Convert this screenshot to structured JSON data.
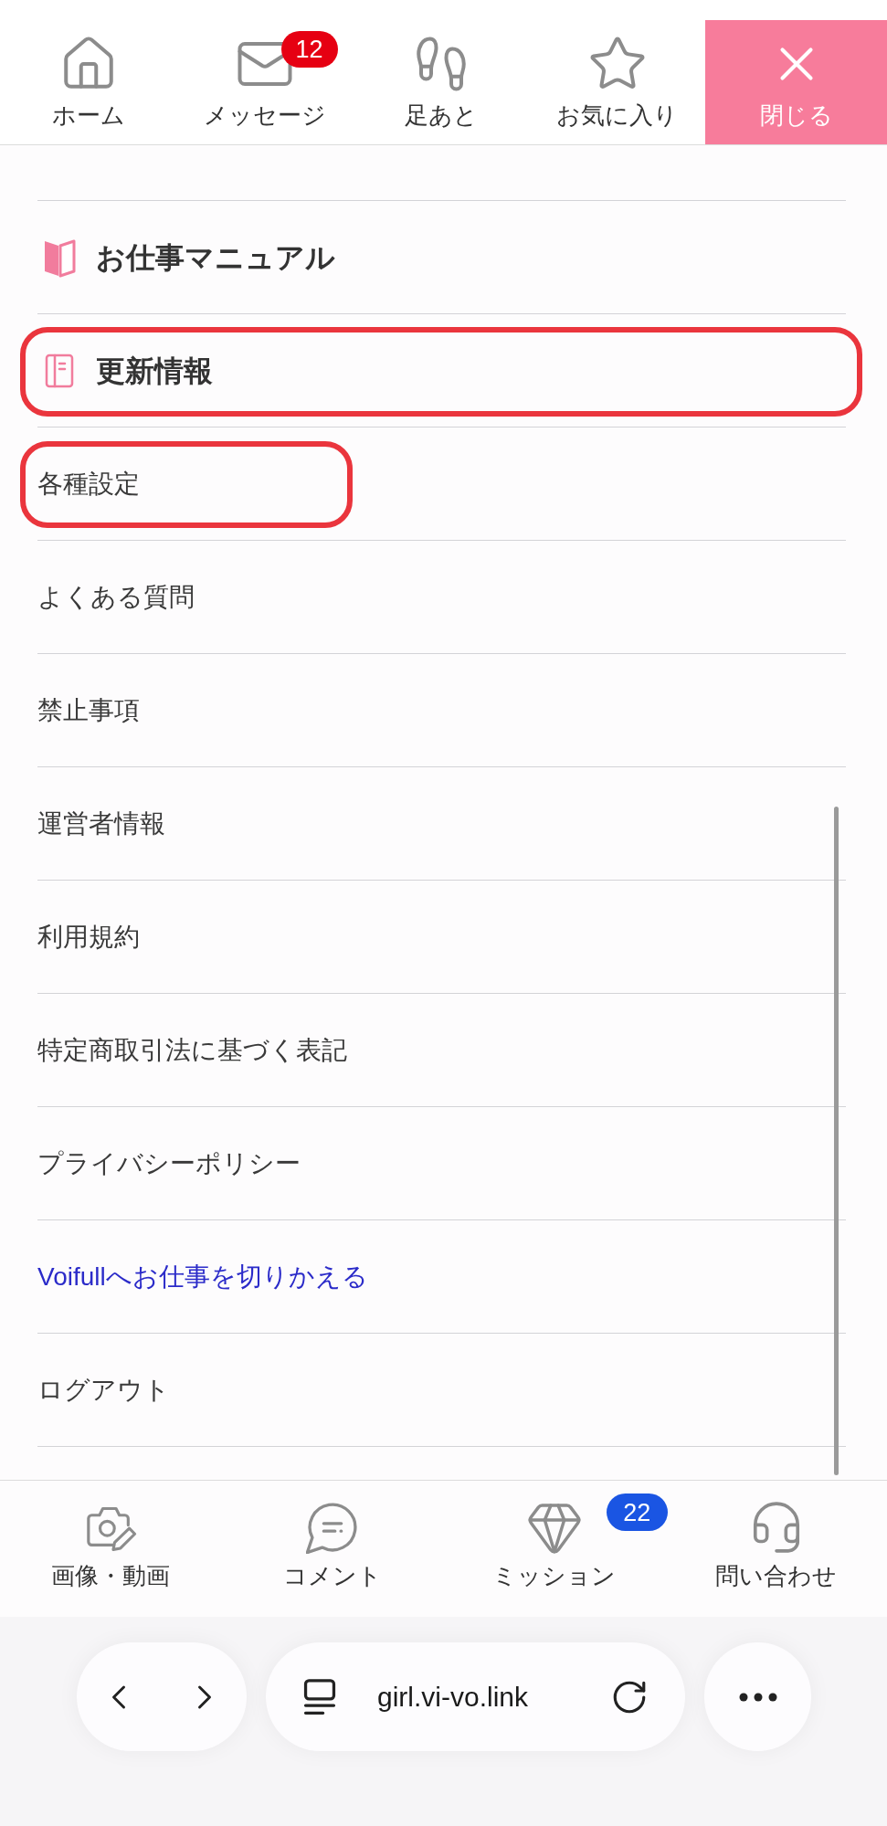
{
  "top_nav": {
    "items": [
      {
        "label": "ホーム"
      },
      {
        "label": "メッセージ",
        "badge": "12"
      },
      {
        "label": "足あと"
      },
      {
        "label": "お気に入り"
      }
    ],
    "close_button": {
      "label": "閉じる"
    }
  },
  "menu": {
    "items": [
      {
        "kind": "section",
        "label": "お仕事マニュアル",
        "highlighted": false
      },
      {
        "kind": "section",
        "label": "更新情報",
        "highlighted": true
      },
      {
        "kind": "item",
        "label": "各種設定",
        "highlighted": true
      },
      {
        "kind": "item",
        "label": "よくある質問",
        "highlighted": false
      },
      {
        "kind": "item",
        "label": "禁止事項",
        "highlighted": false
      },
      {
        "kind": "item",
        "label": "運営者情報",
        "highlighted": false
      },
      {
        "kind": "item",
        "label": "利用規約",
        "highlighted": false
      },
      {
        "kind": "item",
        "label": "特定商取引法に基づく表記",
        "highlighted": false
      },
      {
        "kind": "item",
        "label": "プライバシーポリシー",
        "highlighted": false
      },
      {
        "kind": "accent",
        "label": "Voifullへお仕事を切りかえる",
        "highlighted": false
      },
      {
        "kind": "item",
        "label": "ログアウト",
        "highlighted": false
      }
    ]
  },
  "bottom_nav": {
    "items": [
      {
        "label": "画像・動画"
      },
      {
        "label": "コメント"
      },
      {
        "label": "ミッション",
        "badge": "22"
      },
      {
        "label": "問い合わせ"
      }
    ]
  },
  "browser_bar": {
    "url": "girl.vi-vo.link"
  }
}
